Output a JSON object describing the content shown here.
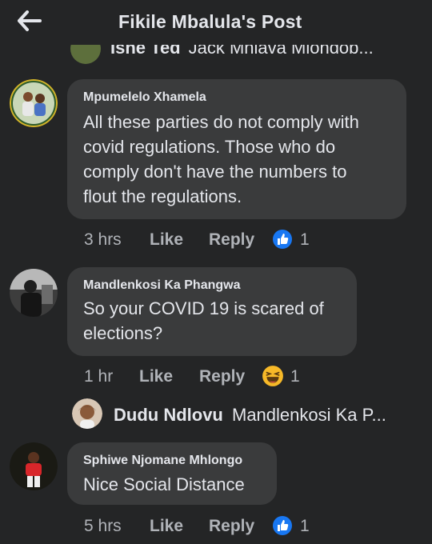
{
  "header": {
    "title": "Fikile Mbalula's Post",
    "back_icon": "arrow-left-icon"
  },
  "cut_off_reply": {
    "name": "Ishe Ted",
    "preview": "Jack Mhlava Mlondob..."
  },
  "comments": [
    {
      "name": "Mpumelelo Xhamela",
      "lines": [
        "All these parties do not comply with",
        "covid regulations. Those who do",
        "comply don't have the numbers to",
        "flout the regulations."
      ],
      "time": "3 hrs",
      "like": "Like",
      "reply": "Reply",
      "reaction": "like-reaction-icon",
      "count": "1"
    },
    {
      "name": "Mandlenkosi Ka Phangwa",
      "lines": [
        "So your COVID 19 is scared of",
        "elections?"
      ],
      "time": "1 hr",
      "like": "Like",
      "reply": "Reply",
      "reaction": "haha-reaction-icon",
      "count": "1"
    },
    {
      "name": "Sphiwe Njomane Mhlongo",
      "lines": [
        "Nice Social Distance"
      ],
      "time": "5 hrs",
      "like": "Like",
      "reply": "Reply",
      "reaction": "like-reaction-icon",
      "count": "1"
    }
  ],
  "nested_reply": {
    "name": "Dudu Ndlovu",
    "preview": "Mandlenkosi Ka P..."
  },
  "colors": {
    "background": "#242526",
    "bubble": "#3a3b3c",
    "text": "#e4e6eb",
    "muted": "#b0b3b8",
    "like_blue": "#1877f2",
    "haha_yellow": "#f7b928"
  }
}
